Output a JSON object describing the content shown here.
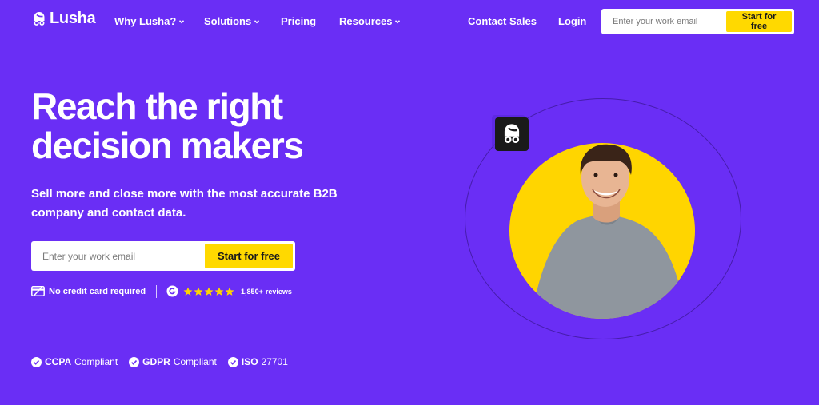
{
  "nav": {
    "brand": "Lusha",
    "links": [
      "Why Lusha?",
      "Solutions",
      "Pricing",
      "Resources"
    ],
    "contact_sales": "Contact Sales",
    "login": "Login",
    "email_placeholder": "Enter your work email",
    "cta": "Start for free"
  },
  "hero": {
    "headline": "Reach the right decision makers",
    "subhead": "Sell more and close more with the most accurate B2B company and contact data.",
    "email_placeholder": "Enter your work email",
    "cta": "Start for free",
    "no_card": "No credit card required",
    "review_rating_stars": 5,
    "review_count": "1,850+",
    "review_word": "reviews"
  },
  "compliance": [
    {
      "bold": "CCPA",
      "rest": "Compliant"
    },
    {
      "bold": "GDPR",
      "rest": "Compliant"
    },
    {
      "bold": "ISO",
      "rest": "27701"
    }
  ],
  "colors": {
    "background": "#6a2ef5",
    "accent_yellow": "#ffd900",
    "circle_yellow": "#ffd500",
    "shirt_gray": "#8f969e",
    "icon_dark": "#1a1a1a"
  },
  "icons": [
    "lusha-logo-icon",
    "chevron-down-icon",
    "credit-card-icon",
    "g2-icon",
    "star-icon",
    "check-circle-icon",
    "lusha-badge-icon"
  ]
}
